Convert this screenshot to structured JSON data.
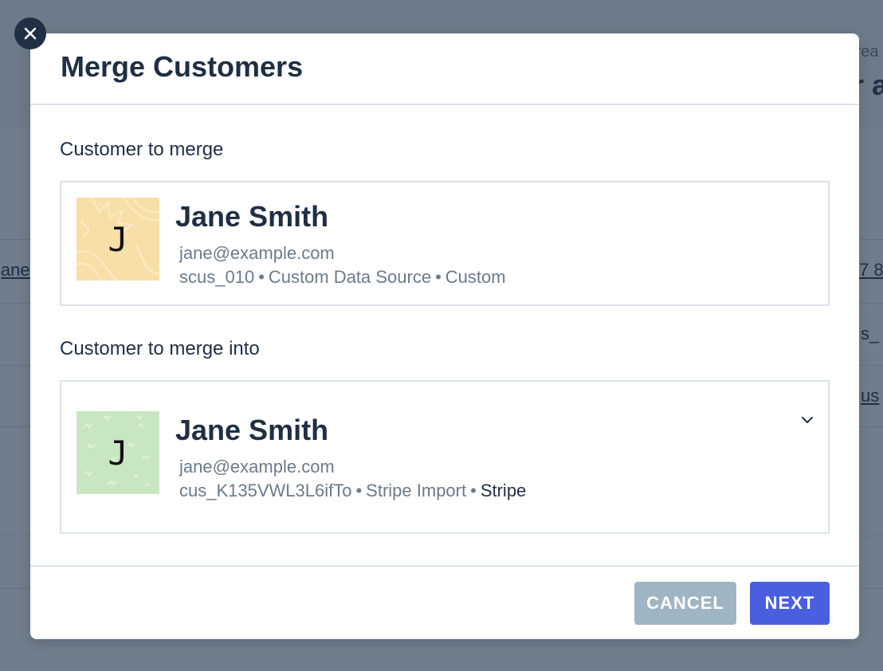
{
  "background": {
    "fragment_small": "trea",
    "fragment_big": "r a",
    "fragment_left_link": "jane",
    "fragment_right_1": "7 8",
    "fragment_right_2": "s_",
    "fragment_right_3": "us"
  },
  "modal": {
    "title": "Merge Customers",
    "source_label": "Customer to merge",
    "target_label": "Customer to merge into",
    "source": {
      "avatar_letter": "J",
      "avatar_color": "#f8dfa8",
      "name": "Jane Smith",
      "email": "jane@example.com",
      "id": "scus_010",
      "source_name": "Custom Data Source",
      "source_type": "Custom"
    },
    "target": {
      "avatar_letter": "J",
      "avatar_color": "#c9e6c3",
      "name": "Jane Smith",
      "email": "jane@example.com",
      "id": "cus_K135VWL3L6ifTo",
      "source_name": "Stripe Import",
      "source_type": "Stripe"
    },
    "separator": "•",
    "cancel_label": "CANCEL",
    "next_label": "NEXT"
  },
  "icons": {
    "close": "close-icon",
    "dropdown": "chevron-down-icon"
  }
}
